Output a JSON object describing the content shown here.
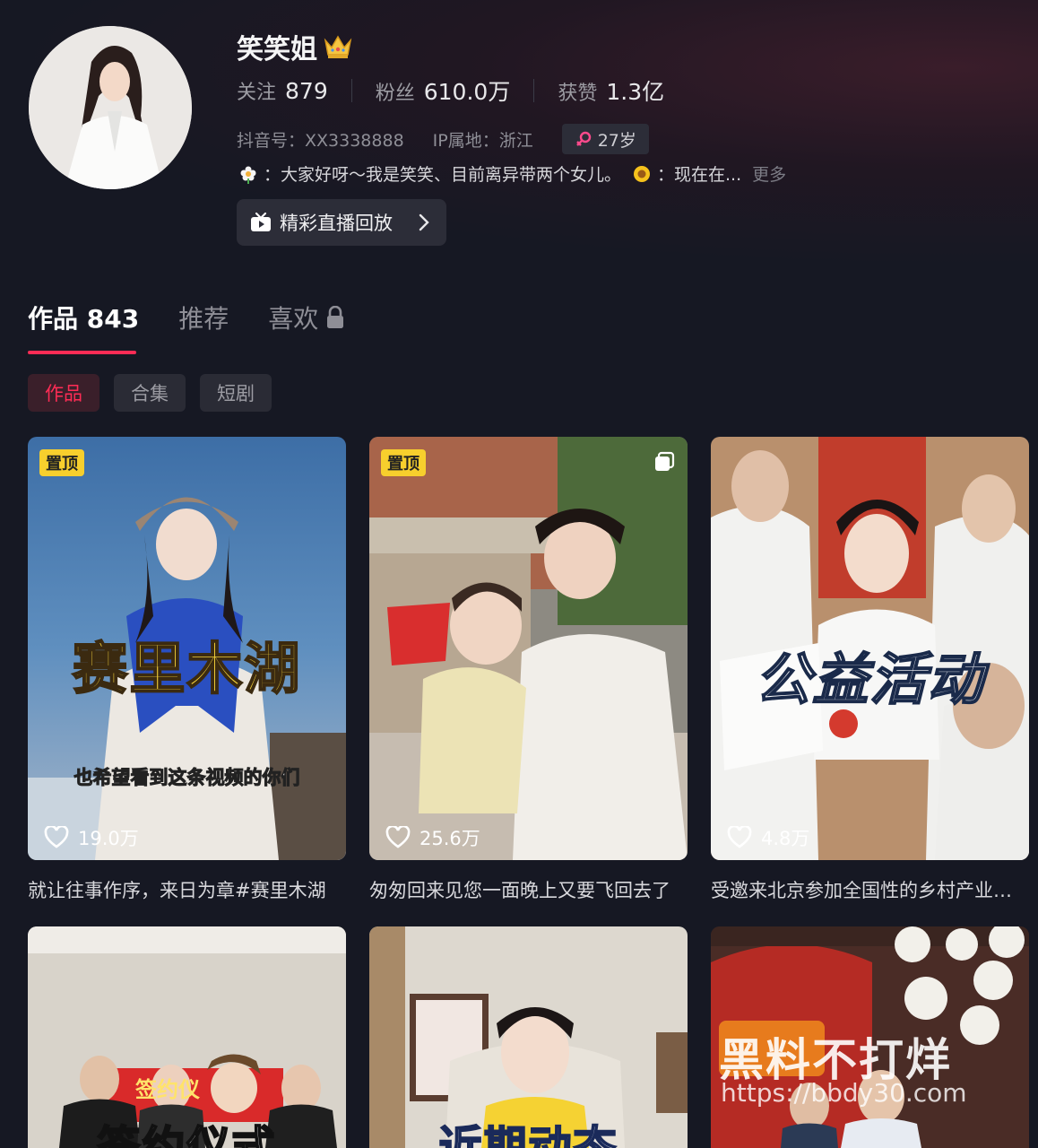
{
  "profile": {
    "name": "笑笑姐",
    "stats": [
      {
        "label": "关注",
        "value": "879"
      },
      {
        "label": "粉丝",
        "value": "610.0万"
      },
      {
        "label": "获赞",
        "value": "1.3亿"
      }
    ],
    "douyin_id": "抖音号：XX3338888",
    "ip_location": "IP属地：浙江",
    "age": "27岁",
    "bio_part1": "：大家好呀～我是笑笑、目前离异带两个女儿。",
    "bio_part2": "：现在在...",
    "bio_more": "更多",
    "live_replay_label": "精彩直播回放"
  },
  "tabs": [
    {
      "label": "作品 843",
      "active": true
    },
    {
      "label": "推荐",
      "active": false
    },
    {
      "label": "喜欢",
      "active": false,
      "locked": true
    }
  ],
  "subtabs": [
    {
      "label": "作品",
      "active": true
    },
    {
      "label": "合集",
      "active": false
    },
    {
      "label": "短剧",
      "active": false
    }
  ],
  "videos": [
    {
      "pinned": true,
      "pin_label": "置顶",
      "overlay_title": "赛里木湖",
      "overlay_sub": "也希望看到这条视频的你们",
      "likes": "19.0万",
      "title": "就让往事作序，来日为章#赛里木湖"
    },
    {
      "pinned": true,
      "pin_label": "置顶",
      "multi_image": true,
      "likes": "25.6万",
      "title": "匆匆回来见您一面晚上又要飞回去了"
    },
    {
      "pinned": false,
      "overlay_title": "公益活动",
      "likes": "4.8万",
      "title": "受邀来北京参加全国性的乡村产业活动"
    },
    {
      "pinned": false,
      "overlay_title": "签约仪式",
      "sign_text": "签约仪"
    },
    {
      "pinned": false,
      "overlay_title": "近期动态"
    },
    {
      "pinned": false
    }
  ],
  "watermark": {
    "text": "黑料不打烊",
    "url": "https://bbdy30.com"
  },
  "colors": {
    "accent": "#fe2c55",
    "pin": "#f7cf2d",
    "background": "#161823"
  }
}
